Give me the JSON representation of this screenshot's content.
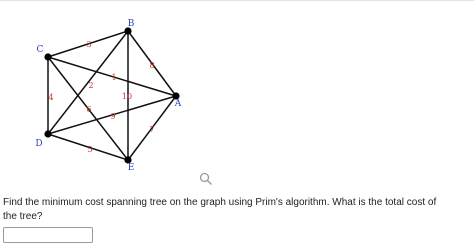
{
  "graph": {
    "nodes": [
      {
        "id": "A",
        "label": "A"
      },
      {
        "id": "B",
        "label": "B"
      },
      {
        "id": "C",
        "label": "C"
      },
      {
        "id": "D",
        "label": "D"
      },
      {
        "id": "E",
        "label": "E"
      }
    ],
    "edges": [
      {
        "from": "C",
        "to": "B",
        "weight": "3"
      },
      {
        "from": "B",
        "to": "A",
        "weight": "8"
      },
      {
        "from": "C",
        "to": "A",
        "weight": "1"
      },
      {
        "from": "B",
        "to": "D",
        "weight": "2"
      },
      {
        "from": "C",
        "to": "D",
        "weight": "4"
      },
      {
        "from": "C",
        "to": "E",
        "weight": "6"
      },
      {
        "from": "B",
        "to": "E",
        "weight": "10"
      },
      {
        "from": "D",
        "to": "A",
        "weight": "9"
      },
      {
        "from": "A",
        "to": "E",
        "weight": "7"
      },
      {
        "from": "D",
        "to": "E",
        "weight": "5"
      }
    ],
    "colors": {
      "node_label": "#2a3fbf",
      "weight_label": "#c0392b",
      "edge": "#111111"
    }
  },
  "question": {
    "text": "Find the minimum cost spanning tree on the graph using Prim's algorithm. What is the total cost of the tree?"
  },
  "answer": {
    "value": "",
    "placeholder": ""
  },
  "icons": {
    "zoom": "search-icon"
  }
}
